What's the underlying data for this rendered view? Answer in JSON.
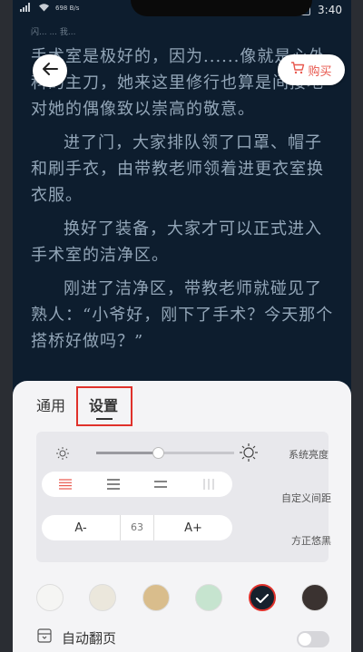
{
  "status_bar": {
    "signal_text": "698 B/s",
    "battery": "85",
    "time": "3:40",
    "notice": "闪...   ...  我..."
  },
  "reader": {
    "paragraphs": [
      "手术室是极好的，因为......像就是心外科的主刀，她来这里修行也算是间接地对她的偶像致以崇高的敬意。",
      "进了门，大家排队领了口罩、帽子和刷手衣，由带教老师领着进更衣室换衣服。",
      "换好了装备，大家才可以正式进入手术室的洁净区。",
      "刚进了洁净区，带教老师就碰见了熟人：“小爷好，刚下了手术？今天那个搭桥好做吗？”"
    ]
  },
  "header": {
    "buy_label": "购买"
  },
  "panel": {
    "tabs": [
      {
        "label": "通用"
      },
      {
        "label": "设置"
      }
    ],
    "brightness": {
      "label": "系统亮度",
      "level": 0.45
    },
    "spacing": {
      "label": "自定义间距",
      "selected_index": 0
    },
    "font": {
      "decrease_label": "A-",
      "size": "63",
      "increase_label": "A+",
      "name": "方正悠黑"
    },
    "colors": [
      {
        "color": "#f5f5f3",
        "selected": false
      },
      {
        "color": "#ebe7dc",
        "selected": false
      },
      {
        "color": "#d9bd8c",
        "selected": false
      },
      {
        "color": "#c6e4cf",
        "selected": false
      },
      {
        "color": "#16212d",
        "selected": true
      },
      {
        "color": "#3a3230",
        "selected": false
      }
    ],
    "auto_page": {
      "label": "自动翻页",
      "enabled": false
    }
  },
  "theme": {
    "accent": "#e0312b",
    "buy_color": "#e8584e",
    "reader_bg": "#0d1d2e",
    "reader_text": "#93a6b8"
  }
}
